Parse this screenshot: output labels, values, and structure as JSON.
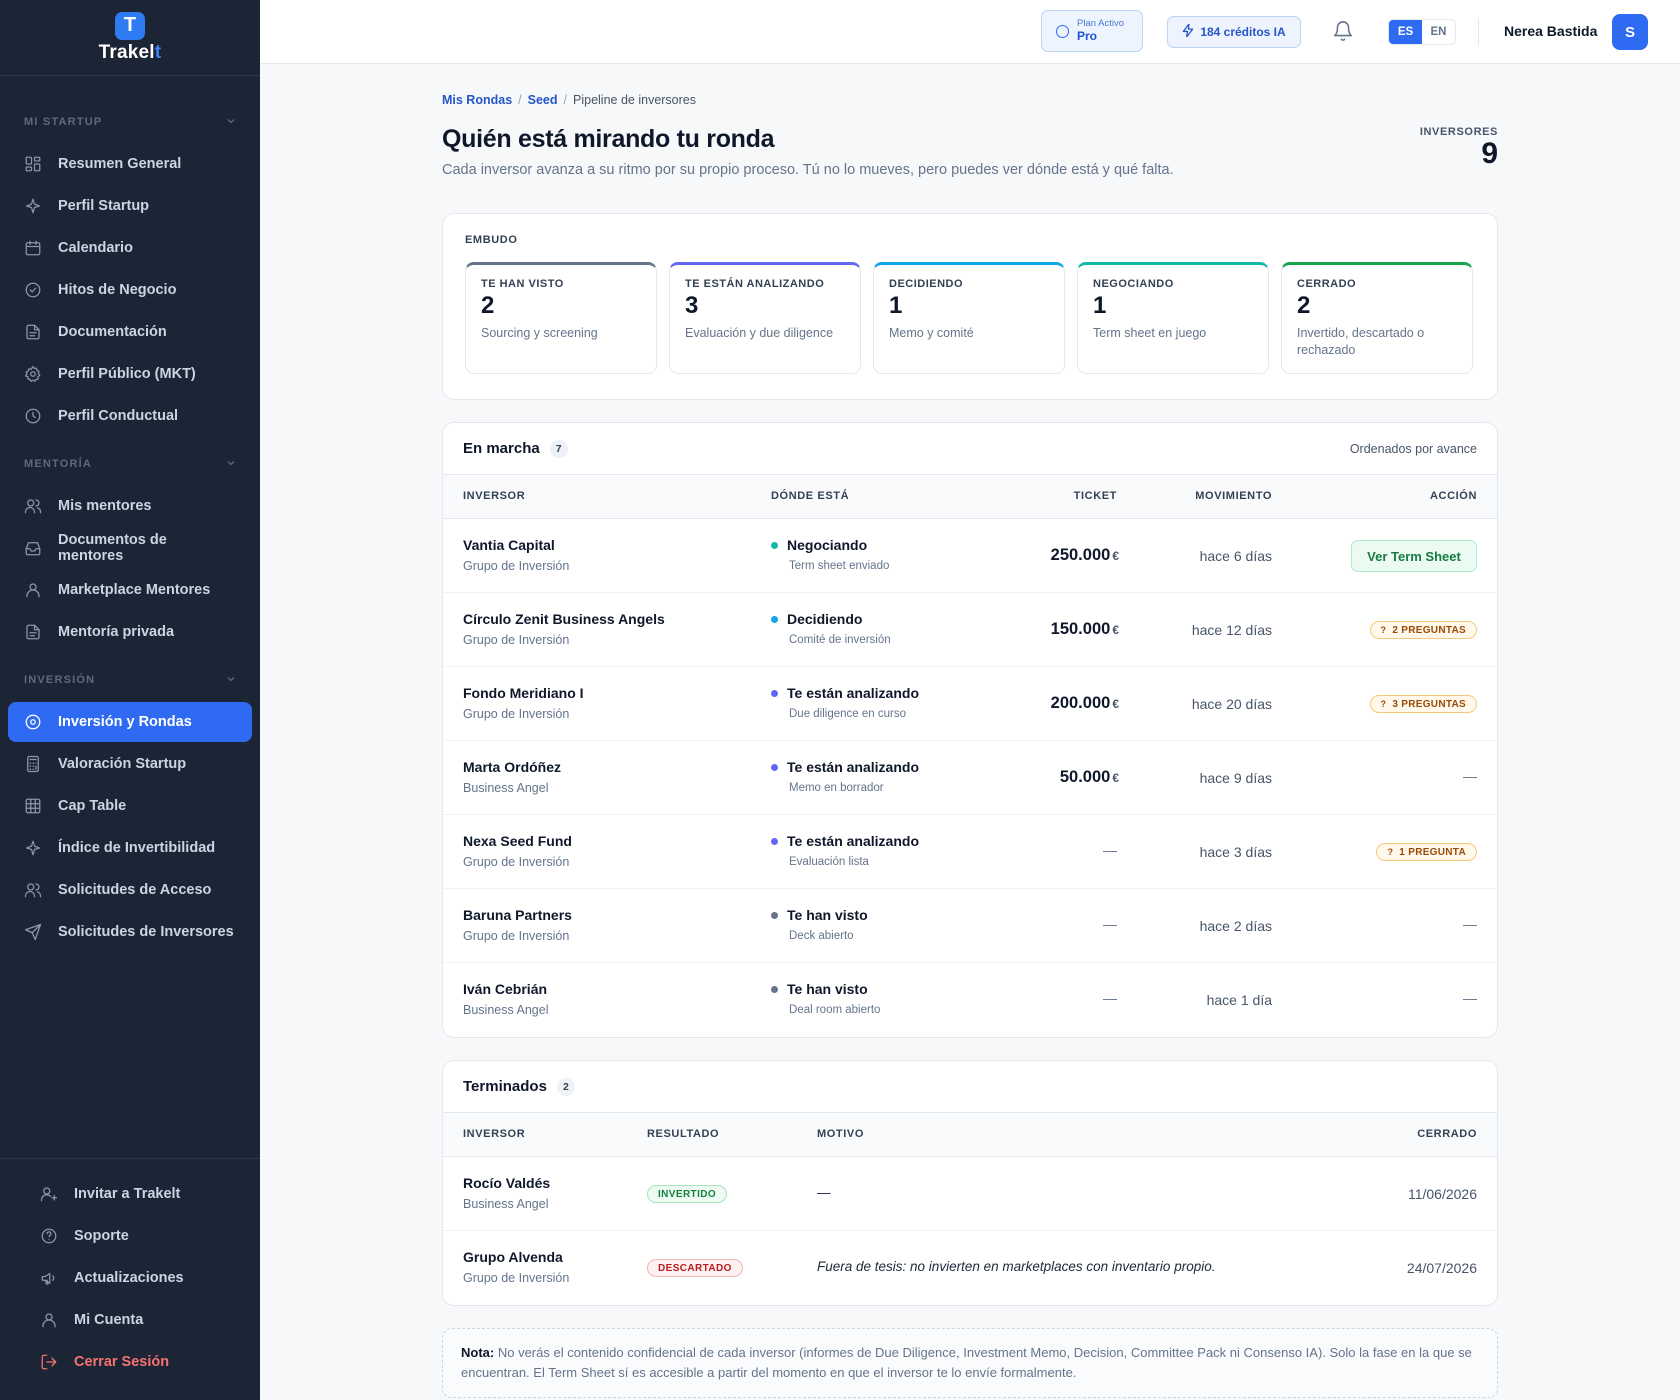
{
  "app": {
    "logo_letter": "T",
    "logo_name": "Trakel",
    "logo_suffix": "t"
  },
  "sidebar": {
    "sections": [
      {
        "title": "MI STARTUP",
        "items": [
          {
            "label": "Resumen General",
            "icon": "grid-icon"
          },
          {
            "label": "Perfil Startup",
            "icon": "sparkle-icon"
          },
          {
            "label": "Calendario",
            "icon": "calendar-icon"
          },
          {
            "label": "Hitos de Negocio",
            "icon": "check-circle-icon"
          },
          {
            "label": "Documentación",
            "icon": "document-icon"
          },
          {
            "label": "Perfil Público (MKT)",
            "icon": "gear-icon"
          },
          {
            "label": "Perfil Conductual",
            "icon": "clock-icon"
          }
        ]
      },
      {
        "title": "MENTORÍA",
        "items": [
          {
            "label": "Mis mentores",
            "icon": "users-icon"
          },
          {
            "label": "Documentos de mentores",
            "icon": "inbox-icon"
          },
          {
            "label": "Marketplace Mentores",
            "icon": "user-icon"
          },
          {
            "label": "Mentoría privada",
            "icon": "document-icon"
          }
        ]
      },
      {
        "title": "INVERSIÓN",
        "items": [
          {
            "label": "Inversión y Rondas",
            "icon": "target-icon",
            "active": true
          },
          {
            "label": "Valoración Startup",
            "icon": "calculator-icon"
          },
          {
            "label": "Cap Table",
            "icon": "table-icon"
          },
          {
            "label": "Índice de Invertibilidad",
            "icon": "sparkle-icon"
          },
          {
            "label": "Solicitudes de Acceso",
            "icon": "users-icon"
          },
          {
            "label": "Solicitudes de Inversores",
            "icon": "send-icon"
          }
        ]
      }
    ],
    "bottom": [
      {
        "label": "Invitar a Trakelt",
        "icon": "user-plus-icon"
      },
      {
        "label": "Soporte",
        "icon": "help-icon"
      },
      {
        "label": "Actualizaciones",
        "icon": "megaphone-icon"
      },
      {
        "label": "Mi Cuenta",
        "icon": "user-icon"
      },
      {
        "label": "Cerrar Sesión",
        "icon": "logout-icon"
      }
    ]
  },
  "topbar": {
    "plan_small": "Plan Activo",
    "plan_name": "Pro",
    "credits": "184 créditos IA",
    "lang_es": "ES",
    "lang_en": "EN",
    "user_name": "Nerea Bastida",
    "avatar_letter": "S"
  },
  "breadcrumb": {
    "b1": "Mis Rondas",
    "b2": "Seed",
    "b3": "Pipeline de inversores"
  },
  "header": {
    "title": "Quién está mirando tu ronda",
    "subtitle": "Cada inversor avanza a su ritmo por su propio proceso. Tú no lo mueves, pero puedes ver dónde está y qué falta.",
    "count_label": "INVERSORES",
    "count": "9"
  },
  "funnel": {
    "label": "EMBUDO",
    "stages": [
      {
        "name": "TE HAN VISTO",
        "count": "2",
        "desc": "Sourcing y screening",
        "color": "#64748b"
      },
      {
        "name": "TE ESTÁN ANALIZANDO",
        "count": "3",
        "desc": "Evaluación y due diligence",
        "color": "#6366f1"
      },
      {
        "name": "DECIDIENDO",
        "count": "1",
        "desc": "Memo y comité",
        "color": "#0ea5e9"
      },
      {
        "name": "NEGOCIANDO",
        "count": "1",
        "desc": "Term sheet en juego",
        "color": "#14b8a6"
      },
      {
        "name": "CERRADO",
        "count": "2",
        "desc": "Invertido, descartado o rechazado",
        "color": "#16a34a"
      }
    ]
  },
  "active": {
    "title": "En marcha",
    "count": "7",
    "sort_note": "Ordenados por avance",
    "headers": {
      "investor": "INVERSOR",
      "where": "DÓNDE ESTÁ",
      "ticket": "TICKET",
      "movement": "MOVIMIENTO",
      "action": "ACCIÓN"
    },
    "rows": [
      {
        "name": "Vantia Capital",
        "type": "Grupo de Inversión",
        "phase": "Negociando",
        "phase_color": "#14b8a6",
        "phase_sub": "Term sheet enviado",
        "ticket": "250.000",
        "currency": "€",
        "movement": "hace 6 días",
        "action_type": "button",
        "action": "Ver Term Sheet"
      },
      {
        "name": "Círculo Zenit Business Angels",
        "type": "Grupo de Inversión",
        "phase": "Decidiendo",
        "phase_color": "#0ea5e9",
        "phase_sub": "Comité de inversión",
        "ticket": "150.000",
        "currency": "€",
        "movement": "hace 12 días",
        "action_type": "badge",
        "action": "2 PREGUNTAS"
      },
      {
        "name": "Fondo Meridiano I",
        "type": "Grupo de Inversión",
        "phase": "Te están analizando",
        "phase_color": "#6366f1",
        "phase_sub": "Due diligence en curso",
        "ticket": "200.000",
        "currency": "€",
        "movement": "hace 20 días",
        "action_type": "badge",
        "action": "3 PREGUNTAS"
      },
      {
        "name": "Marta Ordóñez",
        "type": "Business Angel",
        "phase": "Te están analizando",
        "phase_color": "#6366f1",
        "phase_sub": "Memo en borrador",
        "ticket": "50.000",
        "currency": "€",
        "movement": "hace 9 días",
        "action_type": "dash",
        "action": "—"
      },
      {
        "name": "Nexa Seed Fund",
        "type": "Grupo de Inversión",
        "phase": "Te están analizando",
        "phase_color": "#6366f1",
        "phase_sub": "Evaluación lista",
        "ticket": "—",
        "currency": "",
        "movement": "hace 3 días",
        "action_type": "badge",
        "action": "1 PREGUNTA"
      },
      {
        "name": "Baruna Partners",
        "type": "Grupo de Inversión",
        "phase": "Te han visto",
        "phase_color": "#64748b",
        "phase_sub": "Deck abierto",
        "ticket": "—",
        "currency": "",
        "movement": "hace 2 días",
        "action_type": "dash",
        "action": "—"
      },
      {
        "name": "Iván Cebrián",
        "type": "Business Angel",
        "phase": "Te han visto",
        "phase_color": "#64748b",
        "phase_sub": "Deal room abierto",
        "ticket": "—",
        "currency": "",
        "movement": "hace 1 día",
        "action_type": "dash",
        "action": "—"
      }
    ]
  },
  "finished": {
    "title": "Terminados",
    "count": "2",
    "headers": {
      "investor": "INVERSOR",
      "result": "RESULTADO",
      "reason": "MOTIVO",
      "closed": "CERRADO"
    },
    "rows": [
      {
        "name": "Rocío Valdés",
        "type": "Business Angel",
        "result": "INVERTIDO",
        "result_kind": "invested",
        "reason": "—",
        "closed": "11/06/2026"
      },
      {
        "name": "Grupo Alvenda",
        "type": "Grupo de Inversión",
        "result": "DESCARTADO",
        "result_kind": "discarded",
        "reason": "Fuera de tesis: no invierten en marketplaces con inventario propio.",
        "closed": "24/07/2026"
      }
    ]
  },
  "note": {
    "label": "Nota:",
    "text": "No verás el contenido confidencial de cada inversor (informes de Due Diligence, Investment Memo, Decision, Committee Pack ni Consenso IA). Solo la fase en la que se encuentran. El Term Sheet sí es accesible a partir del momento en que el inversor te lo envíe formalmente."
  }
}
